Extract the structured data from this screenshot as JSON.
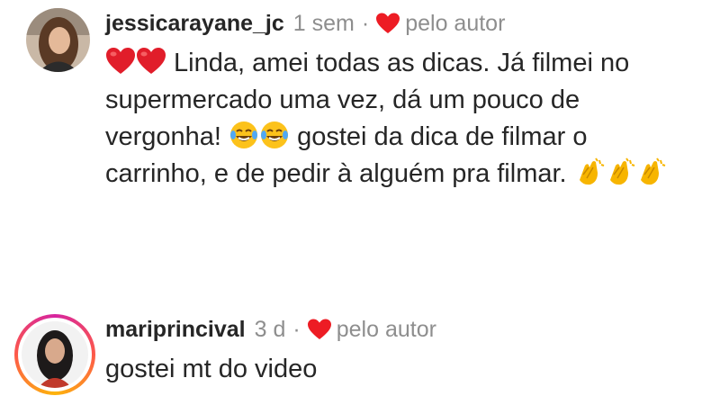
{
  "comments": [
    {
      "username": "jessicarayane_jc",
      "time": "1 sem",
      "liked_label": "pelo autor",
      "text_part1": " Linda, amei todas as dicas. Já filmei no supermercado uma vez, dá um pouco de vergonha! ",
      "text_part2": " gostei da dica de filmar o carrinho, e de pedir à alguém pra filmar. ",
      "has_story_ring": false
    },
    {
      "username": "mariprincival",
      "time": "3 d",
      "liked_label": "pelo autor",
      "text": "gostei mt do video",
      "has_story_ring": true
    }
  ],
  "separator": "·",
  "colors": {
    "heart": "#ed1c24",
    "muted": "#8e8e8e",
    "text": "#262626"
  },
  "icons": [
    "heart-icon",
    "red-heart-emoji",
    "tears-of-joy-emoji",
    "clapping-hands-emoji"
  ]
}
